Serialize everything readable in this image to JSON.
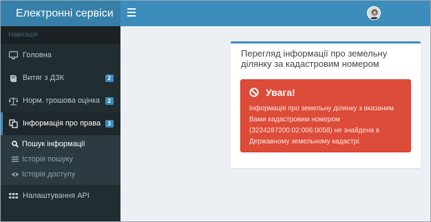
{
  "header": {
    "brand": "Електронні сервіси"
  },
  "sidebar": {
    "heading": "Навігація",
    "items": [
      {
        "label": "Головна",
        "icon": "desktop-icon"
      },
      {
        "label": "Витяг з ДЗК",
        "icon": "book-icon",
        "badge": "2"
      },
      {
        "label": "Норм. грошова оцінка",
        "icon": "balance-scale-icon",
        "badge": "2"
      },
      {
        "label": "Інформація про права",
        "icon": "copy-icon",
        "badge": "3"
      }
    ],
    "submenu": [
      {
        "label": "Пошук інформації",
        "icon": "search-icon"
      },
      {
        "label": "Історія пошуку",
        "icon": "list-icon"
      },
      {
        "label": "Історія доступу",
        "icon": "eye-icon"
      }
    ],
    "settings": {
      "label": "Налаштування API",
      "icon": "grid-icon"
    }
  },
  "box": {
    "title": "Перегляд інформації про земельну ділянку за кадастровим номером",
    "alert": {
      "heading": "Увага!",
      "message": "Інформація про земельну ділянку з вказаним Вами кадастровим номером (3224287200:02:006:0058) не знайдена в Державному земельному кадастрі."
    }
  },
  "colors": {
    "header": "#3c8dbc",
    "sidebar": "#222d32",
    "alert": "#dd4b39",
    "badge": "#3c8dbc"
  }
}
